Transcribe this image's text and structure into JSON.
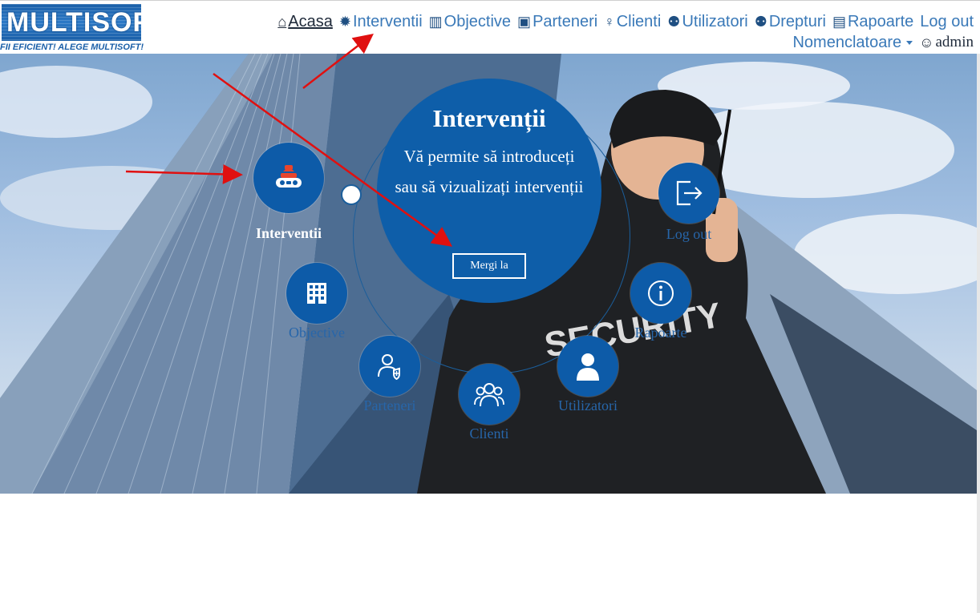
{
  "logo": {
    "name": "MULTISOFT",
    "tagline": "FII EFICIENT! ALEGE MULTISOFT!"
  },
  "nav": {
    "items": [
      {
        "label": "Acasa",
        "icon": "home-icon",
        "glyph": "⌂"
      },
      {
        "label": "Interventii",
        "icon": "cog-icon",
        "glyph": "✹"
      },
      {
        "label": "Objective",
        "icon": "building-icon",
        "glyph": "▥"
      },
      {
        "label": "Parteneri",
        "icon": "briefcase-icon",
        "glyph": "▣"
      },
      {
        "label": "Clienti",
        "icon": "user-icon",
        "glyph": "♀"
      },
      {
        "label": "Utilizatori",
        "icon": "users-icon",
        "glyph": "⚉"
      },
      {
        "label": "Drepturi",
        "icon": "users-icon",
        "glyph": "⚉"
      },
      {
        "label": "Rapoarte",
        "icon": "book-icon",
        "glyph": "▤"
      },
      {
        "label": "Log out"
      }
    ],
    "nomenclatoare": "Nomenclatoare",
    "user": "admin",
    "user_glyph": "☺"
  },
  "menu": {
    "interventii": "Interventii",
    "objective": "Objective",
    "parteneri": "Parteneri",
    "clienti": "Clienti",
    "utilizatori": "Utilizatori",
    "rapoarte": "Rapoarte",
    "logout": "Log out"
  },
  "center": {
    "title": "Intervenții",
    "description": "Vă permite să introduceți sau să vizualizați intervenții",
    "button": "Mergi la"
  },
  "colors": {
    "primary": "#0d5ba8",
    "link": "#3a79b8",
    "accent": "#e8452c"
  }
}
